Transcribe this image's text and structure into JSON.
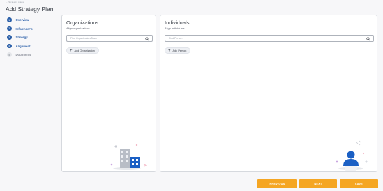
{
  "header": {
    "back_link": "←  Strategy plans",
    "title": "Add Strategy Plan"
  },
  "steps": [
    {
      "num": "1",
      "label": "Overview",
      "active": true
    },
    {
      "num": "2",
      "label": "Influencer’s",
      "active": true
    },
    {
      "num": "3",
      "label": "Strategy",
      "active": true
    },
    {
      "num": "4",
      "label": "Alignment",
      "active": true
    },
    {
      "num": "5",
      "label": "Documents",
      "active": false
    }
  ],
  "organizations": {
    "title": "Organizations",
    "subtitle": "Align organizations",
    "search_placeholder": "Find Organization/Team",
    "search_value": "",
    "add_label": "Add Organization"
  },
  "individuals": {
    "title": "Individuals",
    "subtitle": "Align individuals",
    "search_placeholder": "Find Person",
    "search_value": "",
    "add_label": "Add Person"
  },
  "footer": {
    "previous_label": "PREVIOUS",
    "next_label": "NEXT",
    "save_label": "SAVE"
  },
  "colors": {
    "accent": "#2b5fa8",
    "button": "#f5a623",
    "inactive_step": "#e4e6ea",
    "illustration_blue": "#1a5fc4"
  },
  "icons": {
    "search": "magnifier",
    "add": "plus",
    "org_illustration": "buildings",
    "ind_illustration": "person"
  }
}
